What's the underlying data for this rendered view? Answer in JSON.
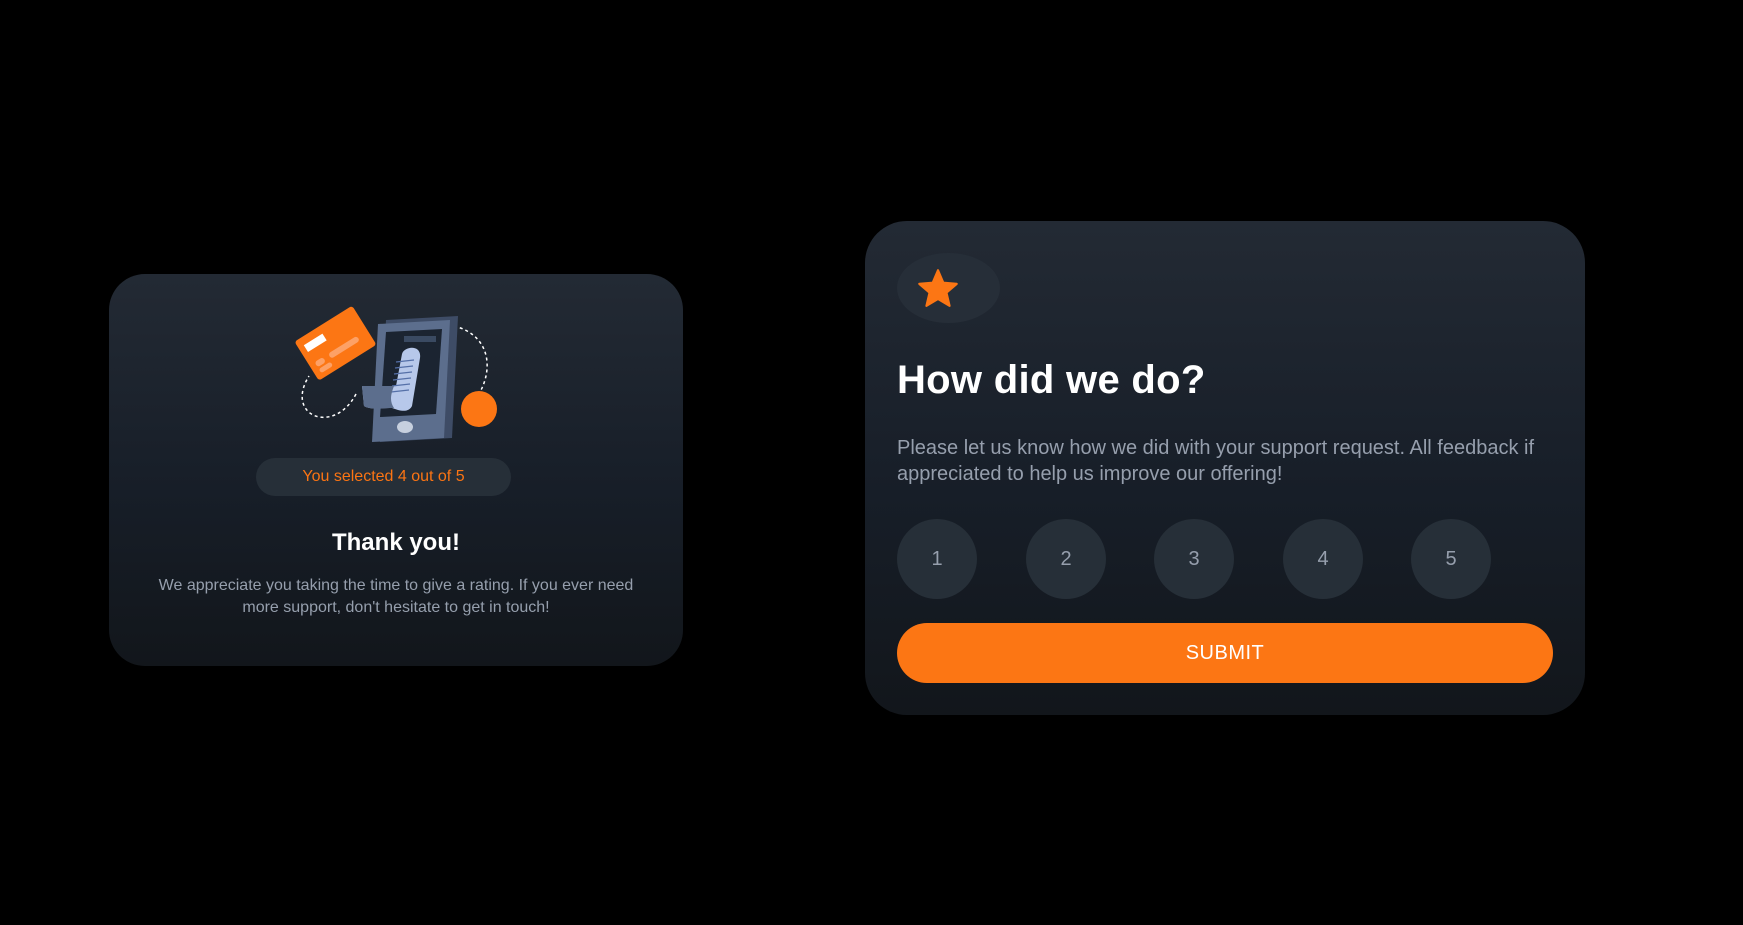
{
  "thank_you_card": {
    "illustration": "payment-receipt-illustration",
    "selected_text": "You selected 4 out of 5",
    "selected_value": 4,
    "max_value": 5,
    "title": "Thank you!",
    "body": "We appreciate you taking the time to give a rating. If you ever need more support, don't hesitate to get in touch!"
  },
  "rating_card": {
    "icon": "star-icon",
    "title": "How did we do?",
    "body": "Please let us know how we did with your support request. All feedback if appreciated to help us improve our offering!",
    "options": [
      {
        "label": "1"
      },
      {
        "label": "2"
      },
      {
        "label": "3"
      },
      {
        "label": "4"
      },
      {
        "label": "5"
      }
    ],
    "submit_label": "SUBMIT"
  },
  "colors": {
    "accent": "#FC7614",
    "background": "#000000",
    "card_top": "#232A34",
    "card_bottom": "#12161B",
    "muted_text": "#969FAD",
    "button_bg": "#262F38"
  }
}
